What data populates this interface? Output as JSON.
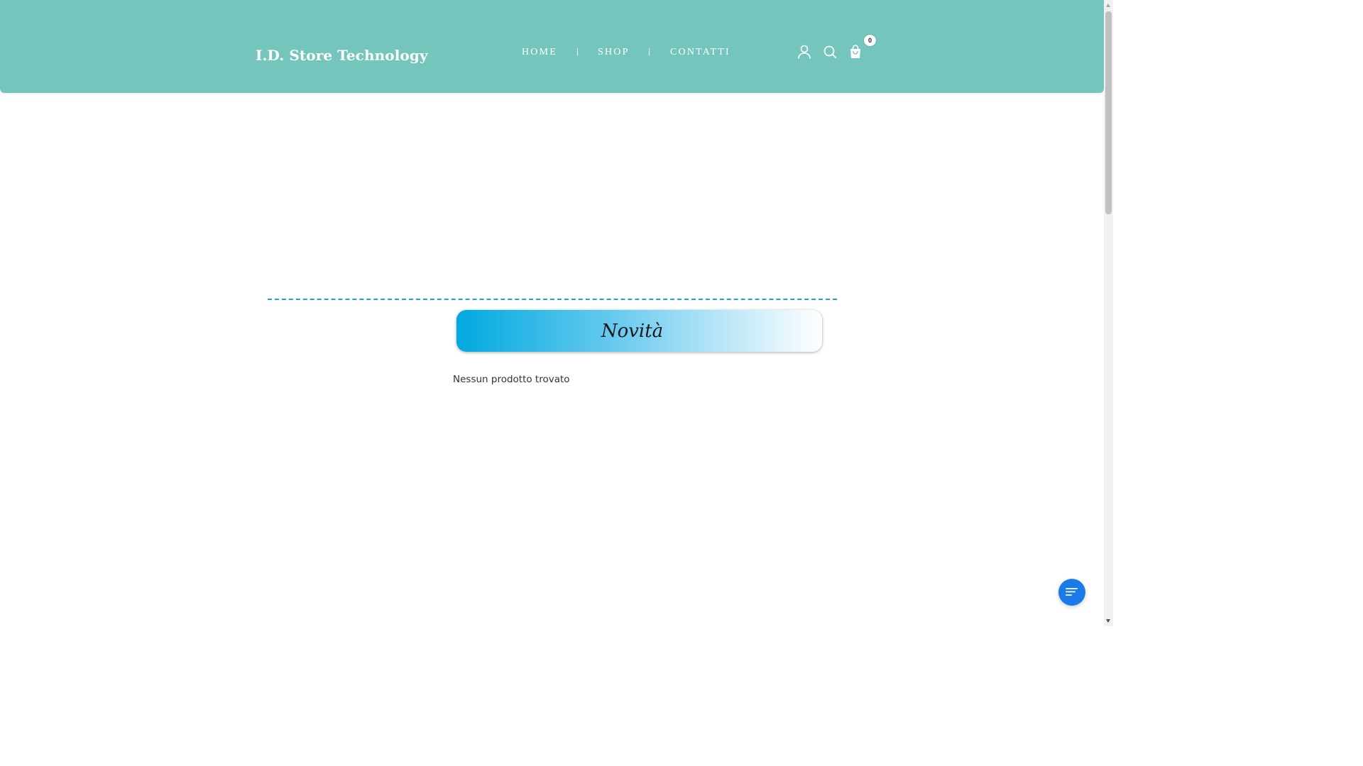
{
  "header": {
    "logo": "I.D. Store Technology",
    "nav": [
      {
        "label": "HOME"
      },
      {
        "label": "SHOP"
      },
      {
        "label": "CONTATTI"
      }
    ],
    "nav_separator": "|",
    "icons": [
      "user-icon",
      "search-icon",
      "shopping-bag-icon"
    ],
    "cart_count": "0",
    "background_color": "#74c6bd"
  },
  "main": {
    "section_title": "Novità",
    "empty_message": "Nessun prodotto trovato",
    "accent_color": "#00a9e0"
  },
  "chat": {
    "icon": "chat-menu-icon",
    "color": "#1a7be8"
  }
}
